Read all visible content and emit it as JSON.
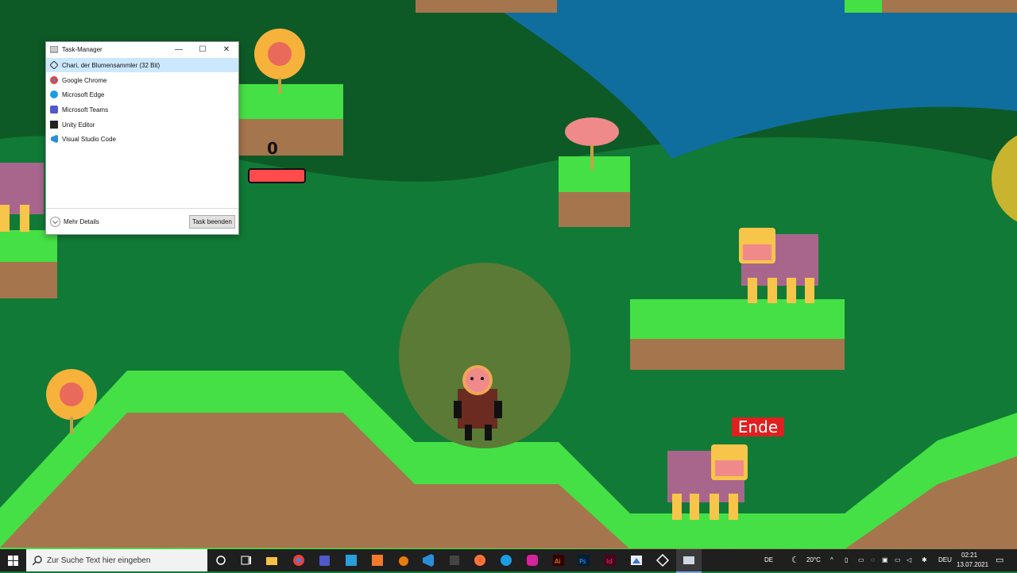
{
  "task_manager": {
    "title": "Task-Manager",
    "apps": [
      {
        "label": "Chari, der Blumensammler (32 Bit)",
        "icon": "unity-icon",
        "selected": true
      },
      {
        "label": "Google Chrome",
        "icon": "chrome-icon",
        "selected": false
      },
      {
        "label": "Microsoft Edge",
        "icon": "edge-icon",
        "selected": false
      },
      {
        "label": "Microsoft Teams",
        "icon": "teams-icon",
        "selected": false
      },
      {
        "label": "Unity Editor",
        "icon": "unity-editor-icon",
        "selected": false
      },
      {
        "label": "Visual Studio Code",
        "icon": "vscode-icon",
        "selected": false
      }
    ],
    "more_details": "Mehr Details",
    "end_task": "Task beenden",
    "window_buttons": {
      "minimize": "—",
      "maximize": "☐",
      "close": "✕"
    }
  },
  "hud": {
    "flower_count": "0",
    "health_fraction": 1.0
  },
  "game": {
    "end_label": "Ende",
    "colors": {
      "sky_water": "#0f6e9e",
      "hill_dark": "#0e5a26",
      "grass": "#45e045",
      "dirt": "#a5754d",
      "health": "#ff4b4b"
    }
  },
  "taskbar": {
    "search_placeholder": "Zur Suche Text hier eingeben",
    "language": "DE",
    "weather": "20°C",
    "keyboard": "DEU",
    "time": "02:21",
    "date": "13.07.2021",
    "pinned": [
      "cortana-icon",
      "task-view-icon",
      "file-explorer-icon",
      "chrome-icon",
      "teams-icon",
      "photoshop-express-icon",
      "sublime-icon",
      "blender-icon",
      "vscode-icon",
      "unity-icon",
      "firefox-icon",
      "edge-icon",
      "instagram-icon",
      "illustrator-icon",
      "photoshop-icon",
      "indesign-icon",
      "paint-icon",
      "unity-hub-icon",
      "task-manager-icon"
    ]
  }
}
